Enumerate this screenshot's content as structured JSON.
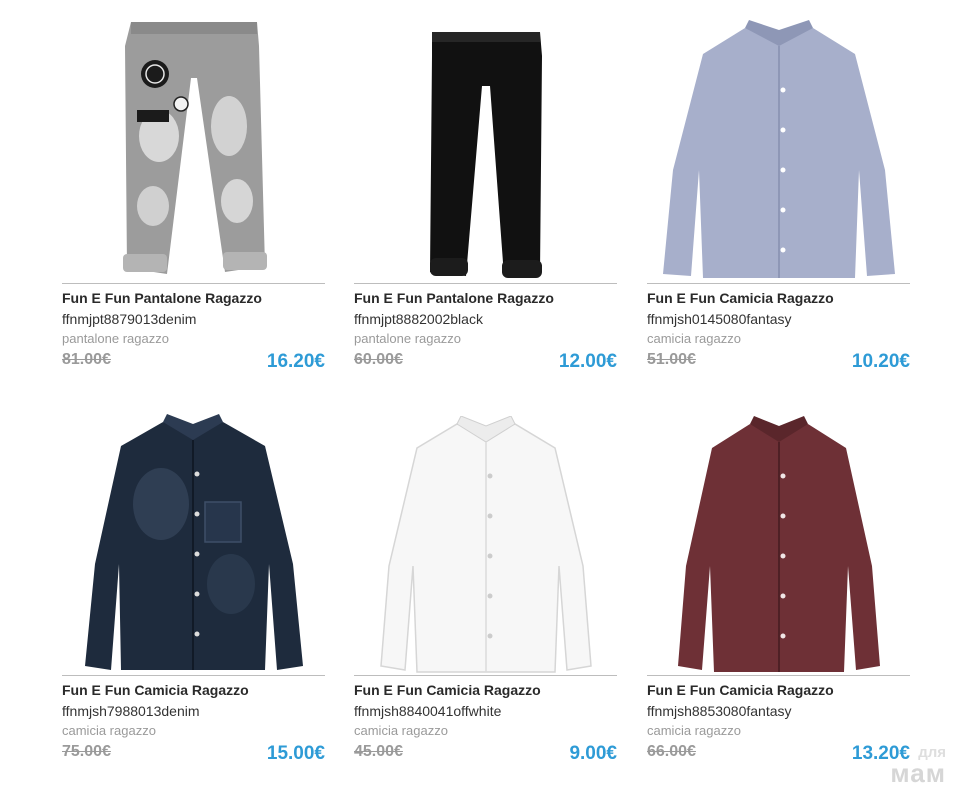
{
  "products": [
    {
      "title": "Fun E Fun Pantalone Ragazzo",
      "code": "ffnmjpt8879013denim",
      "category": "pantalone ragazzo",
      "old_price": "81.00€",
      "price": "16.20€",
      "image": "ripped-grey-jeans-image",
      "color": "#9c9c9c"
    },
    {
      "title": "Fun E Fun Pantalone Ragazzo",
      "code": "ffnmjpt8882002black",
      "category": "pantalone ragazzo",
      "old_price": "60.00€",
      "price": "12.00€",
      "image": "black-pants-image",
      "color": "#111111"
    },
    {
      "title": "Fun E Fun Camicia Ragazzo",
      "code": "ffnmjsh0145080fantasy",
      "category": "camicia ragazzo",
      "old_price": "51.00€",
      "price": "10.20€",
      "image": "light-blue-shirt-image",
      "color": "#a7afcb"
    },
    {
      "title": "Fun E Fun Camicia Ragazzo",
      "code": "ffnmjsh7988013denim",
      "category": "camicia ragazzo",
      "old_price": "75.00€",
      "price": "15.00€",
      "image": "denim-shirt-image",
      "color": "#1e2b3d"
    },
    {
      "title": "Fun E Fun Camicia Ragazzo",
      "code": "ffnmjsh8840041offwhite",
      "category": "camicia ragazzo",
      "old_price": "45.00€",
      "price": "9.00€",
      "image": "white-shirt-image",
      "color": "#f7f7f7"
    },
    {
      "title": "Fun E Fun Camicia Ragazzo",
      "code": "ffnmjsh8853080fantasy",
      "category": "camicia ragazzo",
      "old_price": "66.00€",
      "price": "13.20€",
      "image": "burgundy-shirt-image",
      "color": "#6e3036"
    }
  ],
  "watermark": {
    "top": "для",
    "bottom": "мам"
  },
  "accent_color": "#2e9bd6"
}
